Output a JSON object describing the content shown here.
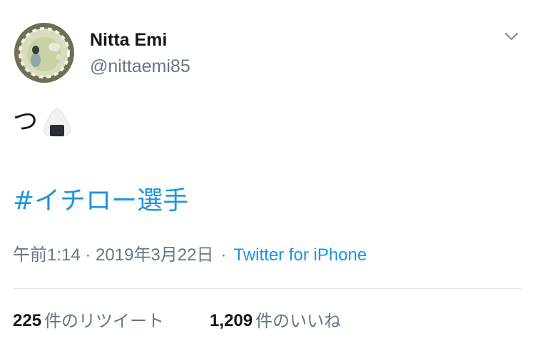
{
  "tweet": {
    "author": {
      "display_name": "Nitta Emi",
      "handle": "@nittaemi85"
    },
    "text": "つ",
    "emoji": "rice-ball-icon",
    "hashtag": "#イチロー選手",
    "timestamp": "午前1:14 · 2019年3月22日",
    "separator": "·",
    "source": "Twitter for iPhone",
    "retweets": {
      "count": "225",
      "label": "件のリツイート"
    },
    "likes": {
      "count": "1,209",
      "label": "件のいいね"
    }
  },
  "colors": {
    "text": "#14171a",
    "secondary": "#657786",
    "link": "#1b95e0",
    "divider": "#e1e8ed"
  }
}
